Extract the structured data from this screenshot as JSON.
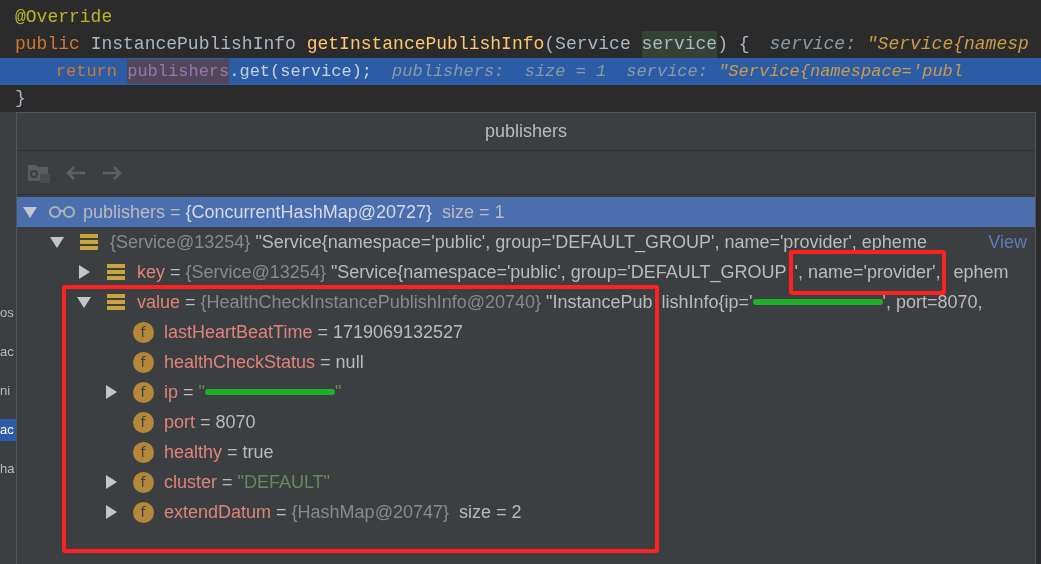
{
  "code_lines": [
    {
      "selected": false,
      "segments": [
        {
          "text": "@Override",
          "kind": "annotation"
        }
      ]
    },
    {
      "selected": false,
      "segments": [
        {
          "text": "public ",
          "kind": "keyword"
        },
        {
          "text": "InstancePublishInfo ",
          "kind": "plain"
        },
        {
          "text": "getInstancePublishInfo",
          "kind": "method"
        },
        {
          "text": "(Service ",
          "kind": "plain"
        },
        {
          "text": "service",
          "kind": "param"
        },
        {
          "text": ") {",
          "kind": "plain"
        },
        {
          "text": "service: ",
          "kind": "hint_label"
        },
        {
          "text": "\"Service{namesp",
          "kind": "hint_value"
        }
      ]
    },
    {
      "selected": true,
      "segments": [
        {
          "text": "    return ",
          "kind": "keyword"
        },
        {
          "text": "publishers",
          "kind": "field"
        },
        {
          "text": ".get(service);",
          "kind": "plain"
        },
        {
          "text": "publishers:  size = 1",
          "kind": "hint_label"
        },
        {
          "text": "service: ",
          "kind": "hint_label"
        },
        {
          "text": "\"Service{namespace='publ",
          "kind": "hint_value"
        }
      ]
    },
    {
      "selected": false,
      "segments": [
        {
          "text": "}",
          "kind": "plain"
        }
      ]
    }
  ],
  "side_fragments": [
    {
      "text": "os",
      "selected": false
    },
    {
      "text": "ac",
      "selected": false
    },
    {
      "text": "ni",
      "selected": false
    },
    {
      "text": "ac",
      "selected": true
    },
    {
      "text": "ha",
      "selected": false
    }
  ],
  "popup": {
    "title": "publishers",
    "tree": [
      {
        "kind": "watch",
        "name": "publishers",
        "selected": true,
        "expanded": true,
        "value": [
          {
            "text": " = ",
            "kind": "plain"
          },
          {
            "text": "{ConcurrentHashMap@20727}",
            "kind": "grey"
          },
          {
            "text": "  size = 1",
            "kind": "plain"
          }
        ],
        "children": [
          {
            "kind": "entry",
            "selected": false,
            "expanded": true,
            "link": "View",
            "value": [
              {
                "text": "{Service@13254}",
                "kind": "grey"
              },
              {
                "text": " \"Service{namespace='public', group='DEFAULT_GROUP', name='provider', epheme",
                "kind": "plain"
              }
            ],
            "children": [
              {
                "kind": "entry",
                "name": "key",
                "selected": false,
                "expanded": false,
                "value": [
                  {
                    "text": " = ",
                    "kind": "plain"
                  },
                  {
                    "text": "{Service@13254}",
                    "kind": "grey"
                  },
                  {
                    "text": " \"Service{namespace='public', group='DEFAULT_GROUP",
                    "kind": "plain"
                  },
                  {
                    "text": "', name='provider',",
                    "kind": "plain"
                  },
                  {
                    "text": " ephem",
                    "kind": "plain"
                  }
                ]
              },
              {
                "kind": "entry",
                "name": "value",
                "selected": false,
                "expanded": true,
                "value": [
                  {
                    "text": " = ",
                    "kind": "plain"
                  },
                  {
                    "text": "{HealthCheckInstancePublishInfo@20740}",
                    "kind": "grey"
                  },
                  {
                    "text": " \"InstancePub",
                    "kind": "plain"
                  },
                  {
                    "text": "lishInfo{ip='",
                    "kind": "plain"
                  },
                  {
                    "kind": "redacted"
                  },
                  {
                    "text": "', port=8070,",
                    "kind": "plain"
                  }
                ],
                "children": [
                  {
                    "kind": "field",
                    "badge": "f",
                    "name": "lastHeartBeatTime",
                    "selected": false,
                    "value": [
                      {
                        "text": " = 1719069132527",
                        "kind": "plain"
                      }
                    ]
                  },
                  {
                    "kind": "field",
                    "badge": "f",
                    "name": "healthCheckStatus",
                    "selected": false,
                    "value": [
                      {
                        "text": " = null",
                        "kind": "plain"
                      }
                    ]
                  },
                  {
                    "kind": "field",
                    "badge": "f",
                    "name": "ip",
                    "selected": false,
                    "expanded": false,
                    "value": [
                      {
                        "text": " = ",
                        "kind": "plain"
                      },
                      {
                        "text": "\"",
                        "kind": "string"
                      },
                      {
                        "kind": "redacted"
                      },
                      {
                        "text": "\"",
                        "kind": "string"
                      }
                    ]
                  },
                  {
                    "kind": "field",
                    "badge": "f",
                    "name": "port",
                    "selected": false,
                    "value": [
                      {
                        "text": " = 8070",
                        "kind": "plain"
                      }
                    ]
                  },
                  {
                    "kind": "field",
                    "badge": "f",
                    "name": "healthy",
                    "selected": false,
                    "value": [
                      {
                        "text": " = true",
                        "kind": "plain"
                      }
                    ]
                  },
                  {
                    "kind": "field",
                    "badge": "f",
                    "name": "cluster",
                    "selected": false,
                    "expanded": false,
                    "value": [
                      {
                        "text": " = ",
                        "kind": "plain"
                      },
                      {
                        "text": "\"DEFAULT\"",
                        "kind": "string"
                      }
                    ]
                  },
                  {
                    "kind": "field",
                    "badge": "f",
                    "name": "extendDatum",
                    "selected": false,
                    "expanded": false,
                    "value": [
                      {
                        "text": " = ",
                        "kind": "plain"
                      },
                      {
                        "text": "{HashMap@20747}",
                        "kind": "grey"
                      },
                      {
                        "text": "  size = 2",
                        "kind": "plain"
                      }
                    ]
                  }
                ]
              }
            ]
          }
        ]
      }
    ]
  }
}
